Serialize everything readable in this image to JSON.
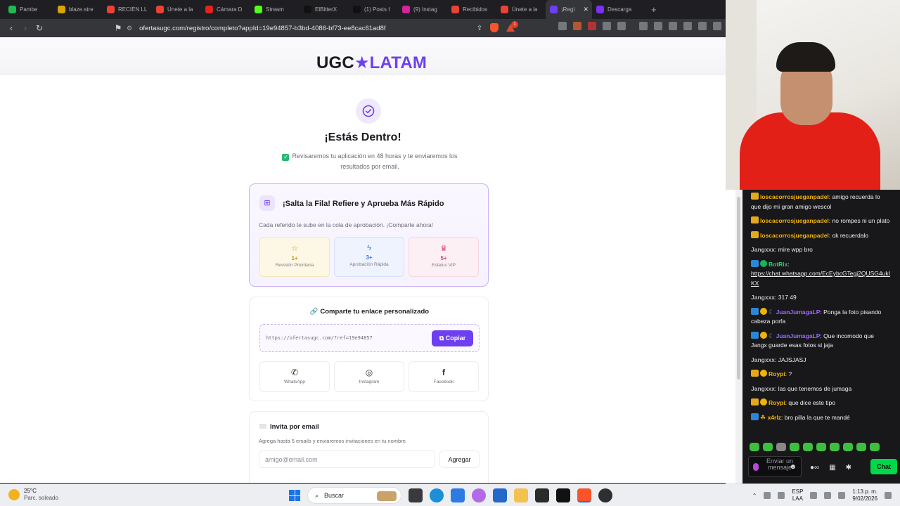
{
  "browser": {
    "tabs": [
      {
        "label": "Pambe",
        "favicon_color": "#1db954"
      },
      {
        "label": "blaze.stre",
        "favicon_color": "#d9a400"
      },
      {
        "label": "RECIÉN LL",
        "favicon_color": "#ea4335"
      },
      {
        "label": "Únete a la",
        "favicon_color": "#ea4335"
      },
      {
        "label": "Cámara D",
        "favicon_color": "#e1251b"
      },
      {
        "label": "Stream",
        "favicon_color": "#53fc18"
      },
      {
        "label": "ElBitterX",
        "favicon_color": "#111111"
      },
      {
        "label": "(1) Posts f",
        "favicon_color": "#111111"
      },
      {
        "label": "(9) Instag",
        "favicon_color": "#d6249f"
      },
      {
        "label": "Recibidos",
        "favicon_color": "#ea4335"
      },
      {
        "label": "Únete a la",
        "favicon_color": "#ea4335"
      },
      {
        "label": "¡Regí",
        "favicon_color": "#6d3ff0",
        "active": true
      },
      {
        "label": "Descarga",
        "favicon_color": "#7b2ff7"
      }
    ],
    "url": "ofertasugc.com/registro/completo?appId=19e94857-b3bd-4086-bf73-ee8cac61ad8f",
    "brave_badge": "1"
  },
  "page": {
    "logo_left": "UGC",
    "logo_star": "★",
    "logo_right": "LATAM",
    "title": "¡Estás Dentro!",
    "subtitle": "Revisaremos tu aplicación en 48 horas y te enviaremos los resultados por email.",
    "refer": {
      "title": "¡Salta la Fila! Refiere y Aprueba Más Rápido",
      "desc": "Cada referido te sube en la cola de aprobación. ¡Comparte ahora!",
      "tiers": [
        {
          "icon": "☆",
          "count": "1+",
          "label": "Revisión Prioritaria"
        },
        {
          "icon": "ϟ",
          "count": "3+",
          "label": "Aprobación Rápida"
        },
        {
          "icon": "♛",
          "count": "5+",
          "label": "Estatus VIP"
        }
      ]
    },
    "share": {
      "title": "🔗 Comparte tu enlace personalizado",
      "link": "https://ofertasugc.com/?ref=19e94857",
      "copy_label": "Copiar",
      "socials": [
        {
          "icon": "✆",
          "label": "WhatsApp"
        },
        {
          "icon": "◎",
          "label": "Instagram"
        },
        {
          "icon": "f",
          "label": "Facebook"
        }
      ]
    },
    "email": {
      "title": "Invita por email",
      "desc": "Agrega hasta 5 emails y enviaremos invitaciones en tu nombre.",
      "placeholder": "amigo@email.com",
      "add_label": "Agregar"
    }
  },
  "chat": {
    "messages": [
      {
        "badges": [
          "crown"
        ],
        "user": "loscacorrosjueganpadel",
        "color": "#f0b30b",
        "text": "amigo recuerda lo que dijo mi gran amigo wescol"
      },
      {
        "badges": [
          "crown"
        ],
        "user": "loscacorrosjueganpadel",
        "color": "#f0b30b",
        "text": "no rompes ni un plato"
      },
      {
        "badges": [
          "crown"
        ],
        "user": "loscacorrosjueganpadel",
        "color": "#f0b30b",
        "text": "ok recuerdalo"
      },
      {
        "badges": [],
        "user": "Jangxxx",
        "color": "#b8b8c0",
        "text": "mire wpp bro"
      },
      {
        "badges": [
          "bot",
          "verif"
        ],
        "user": "BotRix",
        "color": "#2bd26b",
        "text": "",
        "link": "https://chat.whatsapp.com/EcEybcGTegj2QUSG4ukIKX"
      },
      {
        "badges": [],
        "user": "Jangxxx",
        "color": "#b8b8c0",
        "text": "317 49"
      },
      {
        "badges": [
          "bot",
          "gold",
          "moon"
        ],
        "user": "JuanJumagaLP",
        "color": "#9b6cff",
        "text": "Ponga la foto pisando cabeza porfa"
      },
      {
        "badges": [
          "bot",
          "gold",
          "moon"
        ],
        "user": "JuanJumagaLP",
        "color": "#9b6cff",
        "text": "Que incomodo que Jangx guarde esas fotos si jaja"
      },
      {
        "badges": [],
        "user": "Jangxxx",
        "color": "#b8b8c0",
        "text": "JAJSJASJ"
      },
      {
        "badges": [
          "crown",
          "gold"
        ],
        "user": "Roypi",
        "color": "#f0b30b",
        "text": "?"
      },
      {
        "badges": [],
        "user": "Jangxxx",
        "color": "#b8b8c0",
        "text": "las que tenemos de jumaga"
      },
      {
        "badges": [
          "crown",
          "gold"
        ],
        "user": "Roypi",
        "color": "#f0b30b",
        "text": "que dice este tipo"
      },
      {
        "badges": [
          "bot",
          "leaf"
        ],
        "user": "x4rlz",
        "color": "#f0b30b",
        "text": "bro pilla la que te mandé"
      }
    ],
    "input_placeholder": "Enviar un mensaje",
    "send_label": "Chat",
    "chat_button_color": "#00d84a"
  },
  "taskbar": {
    "temp": "25°C",
    "weather": "Parc. soleado",
    "search": "Buscar",
    "lang": "ESP",
    "lang2": "LAA",
    "time": "1:13 p. m.",
    "date": "9/02/2026"
  }
}
